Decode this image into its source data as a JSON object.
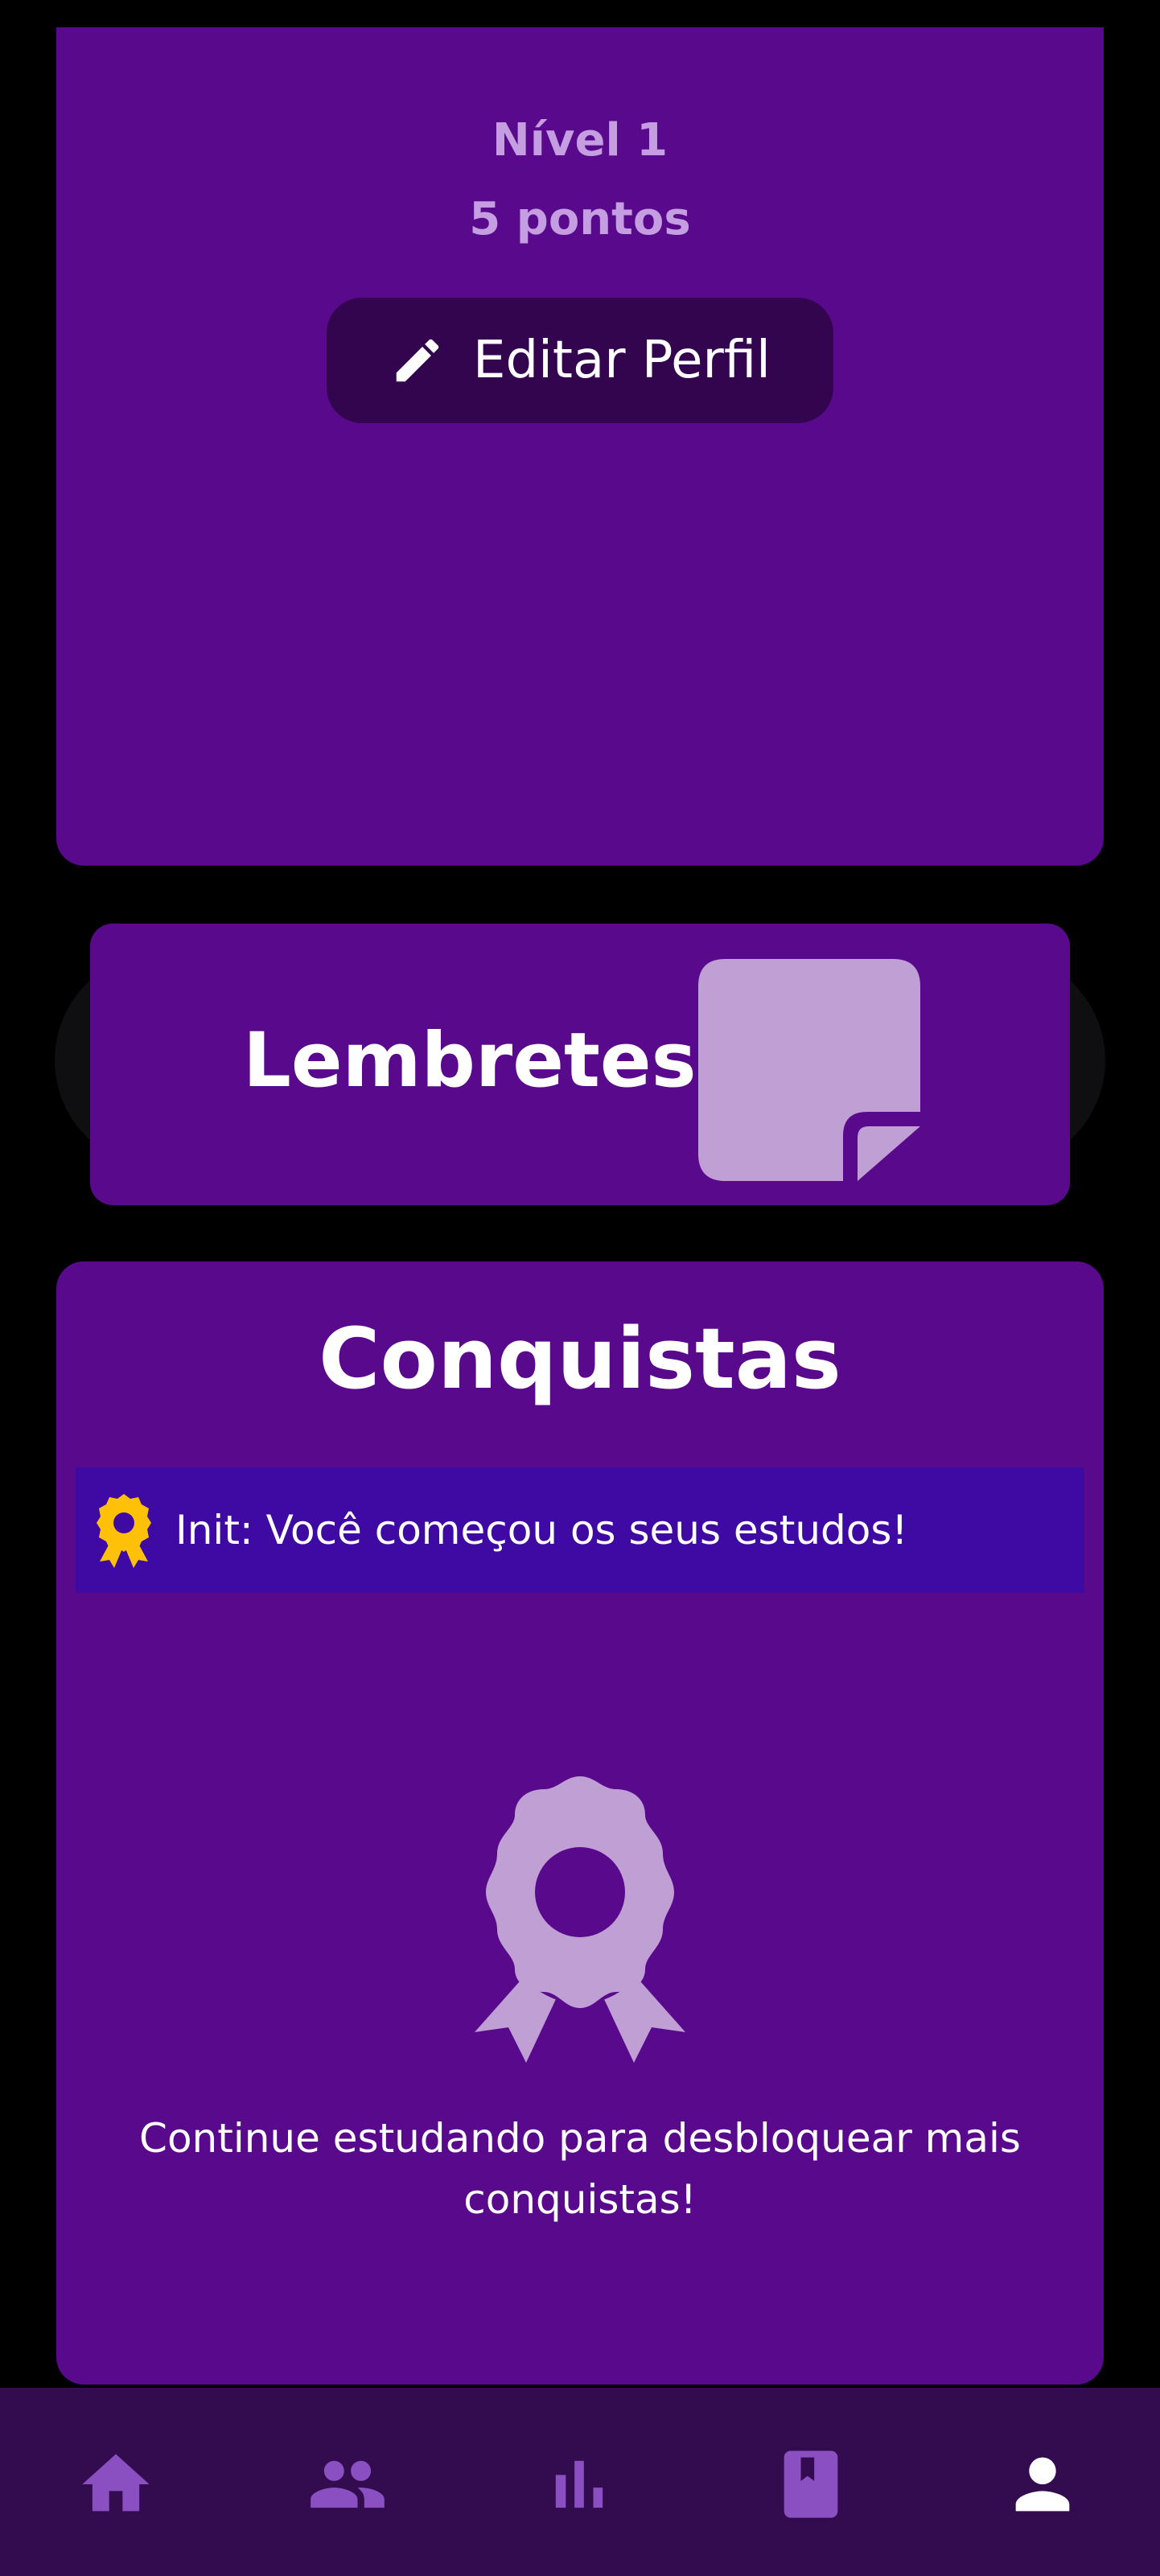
{
  "profile": {
    "level": "Nível 1",
    "points": "5 pontos",
    "edit_button_label": "Editar Perfil"
  },
  "reminders": {
    "title": "Lembretes"
  },
  "achievements": {
    "title": "Conquistas",
    "items": [
      {
        "icon": "medal-icon",
        "text": "Init: Você começou os seus estudos!"
      }
    ],
    "empty_message": "Continue estudando para desbloquear mais conquistas!"
  },
  "bottom_nav": {
    "items": [
      {
        "icon": "home-icon",
        "active": false
      },
      {
        "icon": "people-icon",
        "active": false
      },
      {
        "icon": "bar-chart-icon",
        "active": false
      },
      {
        "icon": "book-icon",
        "active": false
      },
      {
        "icon": "person-icon",
        "active": true
      }
    ]
  },
  "colors": {
    "background": "#000000",
    "card": "#590a8c",
    "button_dark": "#33054f",
    "achievement_row": "#3e0aa3",
    "muted_text": "#c49ee0",
    "nav_background": "#330b4f",
    "nav_inactive": "#8a4fc0",
    "nav_active": "#ffffff",
    "medal_gold": "#ffc107"
  }
}
